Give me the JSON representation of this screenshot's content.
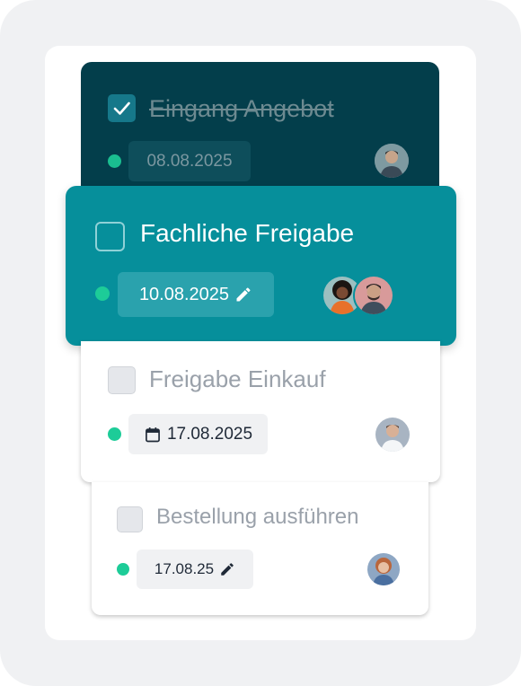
{
  "tasks": [
    {
      "title": "Eingang Angebot",
      "completed": true,
      "date": "08.08.2025",
      "date_icon": "none",
      "status_color": "#1dcc98",
      "assignees": [
        "avatar-man-dark-hair"
      ]
    },
    {
      "title": "Fachliche Freigabe",
      "completed": false,
      "date": "10.08.2025",
      "date_icon": "pencil-icon",
      "status_color": "#1dcc98",
      "assignees": [
        "avatar-woman-curly-hair",
        "avatar-man-beard"
      ]
    },
    {
      "title": "Freigabe Einkauf",
      "completed": false,
      "date": "17.08.2025",
      "date_icon": "calendar-icon",
      "status_color": "#1dcc98",
      "assignees": [
        "avatar-man-shirt"
      ]
    },
    {
      "title": "Bestellung ausführen",
      "completed": false,
      "date": "17.08.25",
      "date_icon": "pencil-icon",
      "status_color": "#1dcc98",
      "assignees": [
        "avatar-woman-red-hair"
      ]
    }
  ],
  "colors": {
    "dark_card": "#033e4b",
    "active_card": "#068f9b",
    "status_green": "#1dcc98"
  }
}
